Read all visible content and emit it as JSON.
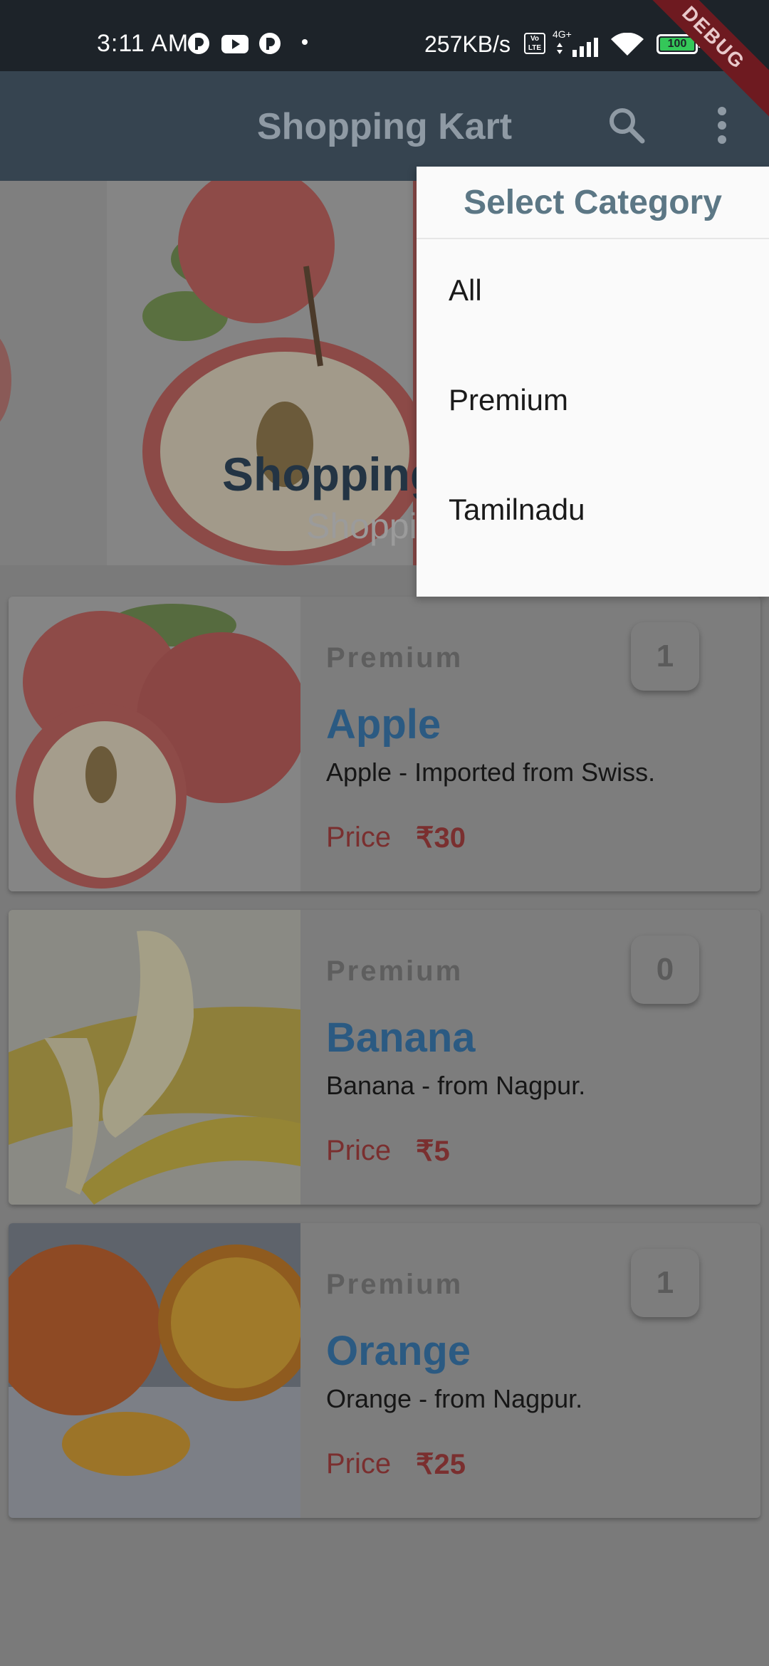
{
  "status_bar": {
    "time": "3:11 AM",
    "network_speed": "257KB/s",
    "volte_label": "Vo LTE",
    "network_type": "4G+",
    "battery": "100",
    "icons": [
      "notification-app-icon",
      "youtube-icon",
      "notification-app-icon",
      "signal-icon",
      "wifi-icon",
      "battery-icon",
      "charging-icon"
    ]
  },
  "debug_banner": "DEBUG",
  "app_bar": {
    "title": "Shopping Kart",
    "search_icon": "search-icon",
    "more_icon": "more-vert-icon"
  },
  "hero": {
    "title": "Shopping",
    "subtitle": "Shoppi"
  },
  "products": [
    {
      "category": "Premium",
      "name": "Apple",
      "description": "Apple - Imported from Swiss.",
      "price_label": "Price",
      "price": "₹30",
      "quantity": "1"
    },
    {
      "category": "Premium",
      "name": "Banana",
      "description": "Banana - from Nagpur.",
      "price_label": "Price",
      "price": "₹5",
      "quantity": "0"
    },
    {
      "category": "Premium",
      "name": "Orange",
      "description": "Orange - from Nagpur.",
      "price_label": "Price",
      "price": "₹25",
      "quantity": "1"
    }
  ],
  "menu": {
    "title": "Select Category",
    "items": [
      "All",
      "Premium",
      "Tamilnadu"
    ]
  },
  "colors": {
    "status_bar": "#1d2329",
    "app_bar": "#364450",
    "scrim": "#7a7a7a",
    "product_name": "#2b5a82",
    "price": "#7a2f2f",
    "menu_title": "#5c7785",
    "debug_banner": "#6e1a20"
  }
}
